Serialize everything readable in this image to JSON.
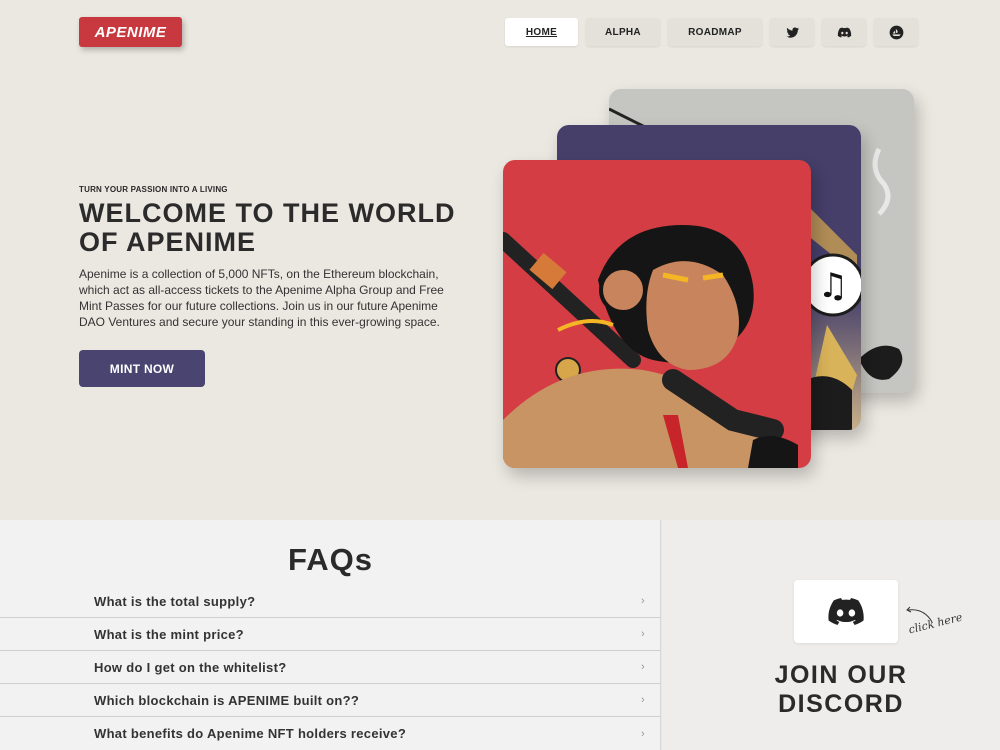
{
  "brand": {
    "logo_text": "APENIME",
    "accent": "#c8393f",
    "purple": "#4a4470"
  },
  "nav": {
    "items": [
      {
        "label": "HOME",
        "active": true
      },
      {
        "label": "ALPHA",
        "active": false
      },
      {
        "label": "ROADMAP",
        "active": false
      }
    ],
    "social": [
      {
        "icon": "twitter-icon"
      },
      {
        "icon": "discord-icon"
      },
      {
        "icon": "opensea-icon"
      }
    ]
  },
  "hero": {
    "tagline": "TURN YOUR PASSION INTO A LIVING",
    "title": "WELCOME TO THE WORLD OF APENIME",
    "description": "Apenime is a collection of 5,000 NFTs, on the Ethereum blockchain, which act as all-access tickets to the Apenime Alpha Group and Free Mint Passes for our future collections. Join us in our future Apenime DAO Ventures and secure your standing in this ever-growing space.",
    "cta_label": "MINT NOW",
    "cards": [
      {
        "name": "grey-card",
        "color": "#c5c6c1"
      },
      {
        "name": "purple-card",
        "color": "#453f6a"
      },
      {
        "name": "red-card",
        "color": "#d43d43"
      }
    ]
  },
  "faq": {
    "title": "FAQs",
    "questions": [
      "What is the total supply?",
      "What is the mint price?",
      "How do I get on the whitelist?",
      "Which blockchain is APENIME built on??",
      "What benefits do Apenime NFT holders receive?"
    ]
  },
  "discord": {
    "title": "JOIN OUR DISCORD",
    "hint": "click here"
  }
}
